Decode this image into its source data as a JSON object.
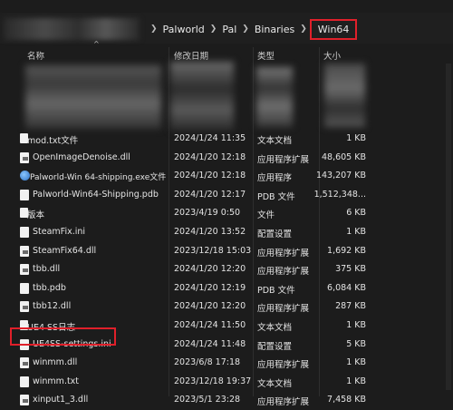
{
  "breadcrumb": {
    "items": [
      "Palworld",
      "Pal",
      "Binaries",
      "Win64"
    ]
  },
  "columns": {
    "name": "名称",
    "date": "修改日期",
    "type": "类型",
    "size": "大小"
  },
  "files": [
    {
      "name": "mod.txt文件",
      "date": "2024/1/24 11:35",
      "type": "文本文档",
      "size": "1 KB",
      "icon": "text-file-icon"
    },
    {
      "name": "OpenImageDenoise.dll",
      "date": "2024/1/20 12:18",
      "type": "应用程序扩展",
      "size": "48,605 KB",
      "icon": "dll-file-icon"
    },
    {
      "name": "Palworld-Win 64-shipping.exe文件",
      "date": "2024/1/20 12:18",
      "type": "应用程序",
      "size": "143,207 KB",
      "icon": "exe-globe-icon"
    },
    {
      "name": "Palworld-Win64-Shipping.pdb",
      "date": "2024/1/20 12:17",
      "type": "PDB 文件",
      "size": "1,512,348...",
      "icon": "file-icon"
    },
    {
      "name": "版本",
      "date": "2023/4/19 0:50",
      "type": "文件",
      "size": "6 KB",
      "icon": "file-icon"
    },
    {
      "name": "SteamFix.ini",
      "date": "2024/1/20 13:52",
      "type": "配置设置",
      "size": "1 KB",
      "icon": "ini-file-icon"
    },
    {
      "name": "SteamFix64.dll",
      "date": "2023/12/18 15:03",
      "type": "应用程序扩展",
      "size": "1,692 KB",
      "icon": "dll-file-icon"
    },
    {
      "name": "tbb.dll",
      "date": "2024/1/20 12:20",
      "type": "应用程序扩展",
      "size": "375 KB",
      "icon": "dll-file-icon"
    },
    {
      "name": "tbb.pdb",
      "date": "2024/1/20 12:19",
      "type": "PDB 文件",
      "size": "6,084 KB",
      "icon": "file-icon"
    },
    {
      "name": "tbb12.dll",
      "date": "2024/1/20 12:20",
      "type": "应用程序扩展",
      "size": "287 KB",
      "icon": "dll-file-icon"
    },
    {
      "name": "UE4 SS日志",
      "date": "2024/1/24 11:50",
      "type": "文本文档",
      "size": "1 KB",
      "icon": "text-file-icon"
    },
    {
      "name": "UE4SS-settings.ini",
      "date": "2024/1/24 11:48",
      "type": "配置设置",
      "size": "5 KB",
      "icon": "ini-file-icon"
    },
    {
      "name": "winmm.dll",
      "date": "2023/6/8 17:18",
      "type": "应用程序扩展",
      "size": "1 KB",
      "icon": "dll-file-icon"
    },
    {
      "name": "winmm.txt",
      "date": "2023/12/18 19:37",
      "type": "文本文档",
      "size": "1 KB",
      "icon": "text-file-icon"
    },
    {
      "name": "xinput1_3.dll",
      "date": "2023/5/1 23:28",
      "type": "应用程序扩展",
      "size": "7,458 KB",
      "icon": "dll-file-icon"
    }
  ],
  "colors": {
    "highlight": "#e0202a",
    "background": "#1c1c1c"
  }
}
